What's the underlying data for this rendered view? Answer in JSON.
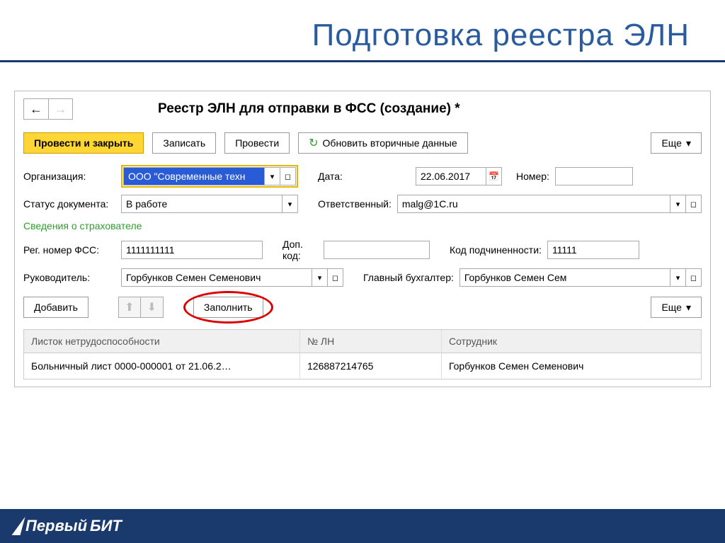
{
  "slide": {
    "title": "Подготовка реестра ЭЛН"
  },
  "window": {
    "title": "Реестр ЭЛН для отправки в ФСС (создание) *"
  },
  "toolbar": {
    "submit_close": "Провести и закрыть",
    "save": "Записать",
    "submit": "Провести",
    "refresh": "Обновить вторичные данные",
    "more": "Еще"
  },
  "fields": {
    "org_label": "Организация:",
    "org_value": "ООО \"Современные техн",
    "date_label": "Дата:",
    "date_value": "22.06.2017",
    "number_label": "Номер:",
    "number_value": "",
    "status_label": "Статус документа:",
    "status_value": "В работе",
    "resp_label": "Ответственный:",
    "resp_value": "malg@1C.ru",
    "section_insurer": "Сведения о страхователе",
    "reg_label": "Рег. номер ФСС:",
    "reg_value": "1111111111",
    "addcode_label": "Доп. код:",
    "addcode_value": "",
    "subcode_label": "Код подчиненности:",
    "subcode_value": "11111",
    "head_label": "Руководитель:",
    "head_value": "Горбунков Семен Семенович",
    "acc_label": "Главный бухгалтер:",
    "acc_value": "Горбунков Семен Сем"
  },
  "actions": {
    "add": "Добавить",
    "fill": "Заполнить",
    "more2": "Еще"
  },
  "table": {
    "headers": {
      "sheet": "Листок нетрудоспособности",
      "num": "№ ЛН",
      "emp": "Сотрудник"
    },
    "row": {
      "sheet": "Больничный лист 0000-000001 от 21.06.2…",
      "num": "126887214765",
      "emp": "Горбунков Семен Семенович"
    }
  },
  "footer": {
    "brand1": "Первый",
    "brand2": "БИТ"
  }
}
